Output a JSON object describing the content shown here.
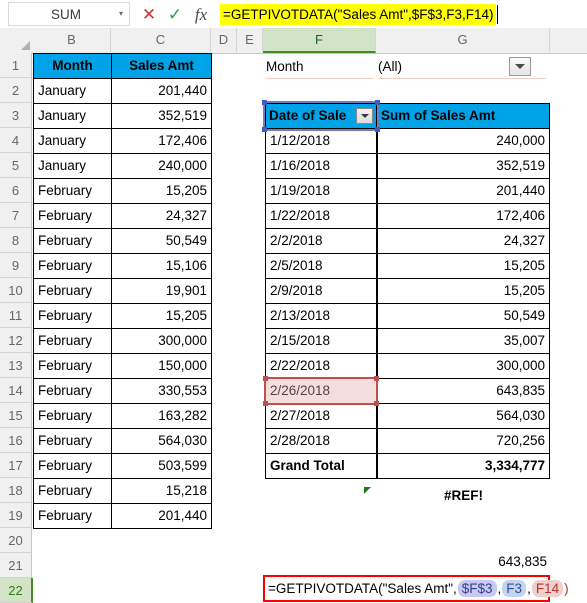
{
  "formula_bar": {
    "name_box_value": "SUM",
    "name_box_arrow": "▾",
    "cancel_icon": "✕",
    "enter_icon": "✓",
    "fx_icon": "fx",
    "formula_text": "=GETPIVOTDATA(\"Sales Amt\",$F$3,F3,F14)"
  },
  "grid": {
    "column_headers": [
      "B",
      "C",
      "D",
      "E",
      "F",
      "G"
    ],
    "active_column": "F",
    "row_headers": [
      "1",
      "2",
      "3",
      "4",
      "5",
      "6",
      "7",
      "8",
      "9",
      "10",
      "11",
      "12",
      "13",
      "14",
      "15",
      "16",
      "17",
      "18",
      "19",
      "20",
      "21",
      "22"
    ],
    "active_row": "22"
  },
  "source_table": {
    "headers": [
      "Month",
      "Sales Amt"
    ],
    "rows": [
      {
        "month": "January",
        "amount": "201,440"
      },
      {
        "month": "January",
        "amount": "352,519"
      },
      {
        "month": "January",
        "amount": "172,406"
      },
      {
        "month": "January",
        "amount": "240,000"
      },
      {
        "month": "February",
        "amount": "15,205"
      },
      {
        "month": "February",
        "amount": "24,327"
      },
      {
        "month": "February",
        "amount": "50,549"
      },
      {
        "month": "February",
        "amount": "15,106"
      },
      {
        "month": "February",
        "amount": "19,901"
      },
      {
        "month": "February",
        "amount": "15,205"
      },
      {
        "month": "February",
        "amount": "300,000"
      },
      {
        "month": "February",
        "amount": "150,000"
      },
      {
        "month": "February",
        "amount": "330,553"
      },
      {
        "month": "February",
        "amount": "163,282"
      },
      {
        "month": "February",
        "amount": "564,030"
      },
      {
        "month": "February",
        "amount": "503,599"
      },
      {
        "month": "February",
        "amount": "15,218"
      },
      {
        "month": "February",
        "amount": "201,440"
      }
    ]
  },
  "pivot": {
    "filter_label": "Month",
    "filter_value": "(All)",
    "filter_dropdown_icon": "dropdown-arrow",
    "headers": [
      "Date of Sale",
      "Sum of Sales Amt"
    ],
    "rows": [
      {
        "date": "1/12/2018",
        "amount": "240,000"
      },
      {
        "date": "1/16/2018",
        "amount": "352,519"
      },
      {
        "date": "1/19/2018",
        "amount": "201,440"
      },
      {
        "date": "1/22/2018",
        "amount": "172,406"
      },
      {
        "date": "2/2/2018",
        "amount": "24,327"
      },
      {
        "date": "2/5/2018",
        "amount": "15,205"
      },
      {
        "date": "2/9/2018",
        "amount": "15,205"
      },
      {
        "date": "2/13/2018",
        "amount": "50,549"
      },
      {
        "date": "2/15/2018",
        "amount": "35,007"
      },
      {
        "date": "2/22/2018",
        "amount": "300,000"
      },
      {
        "date": "2/26/2018",
        "amount": "643,835"
      },
      {
        "date": "2/27/2018",
        "amount": "564,030"
      },
      {
        "date": "2/28/2018",
        "amount": "720,256"
      }
    ],
    "grand_total_label": "Grand Total",
    "grand_total_value": "3,334,777"
  },
  "results": {
    "ref_error": "#REF!",
    "lookup_value": "643,835"
  },
  "edit_cell": {
    "prefix": "=GETPIVOTDATA(\"Sales Amt\",",
    "ref_pivot_table": "$F$3",
    "sep1": ",",
    "ref_field": "F3",
    "sep2": ",",
    "ref_item": "F14",
    "close_paren": ")"
  },
  "colors": {
    "header_blue": "#00a2e8",
    "formula_highlight": "#ffff00",
    "edit_border_red": "#ff0000",
    "active_header_green": "#d3e3c6",
    "ref_blue": "#6a7fc4",
    "ref_red": "#c0504d"
  }
}
